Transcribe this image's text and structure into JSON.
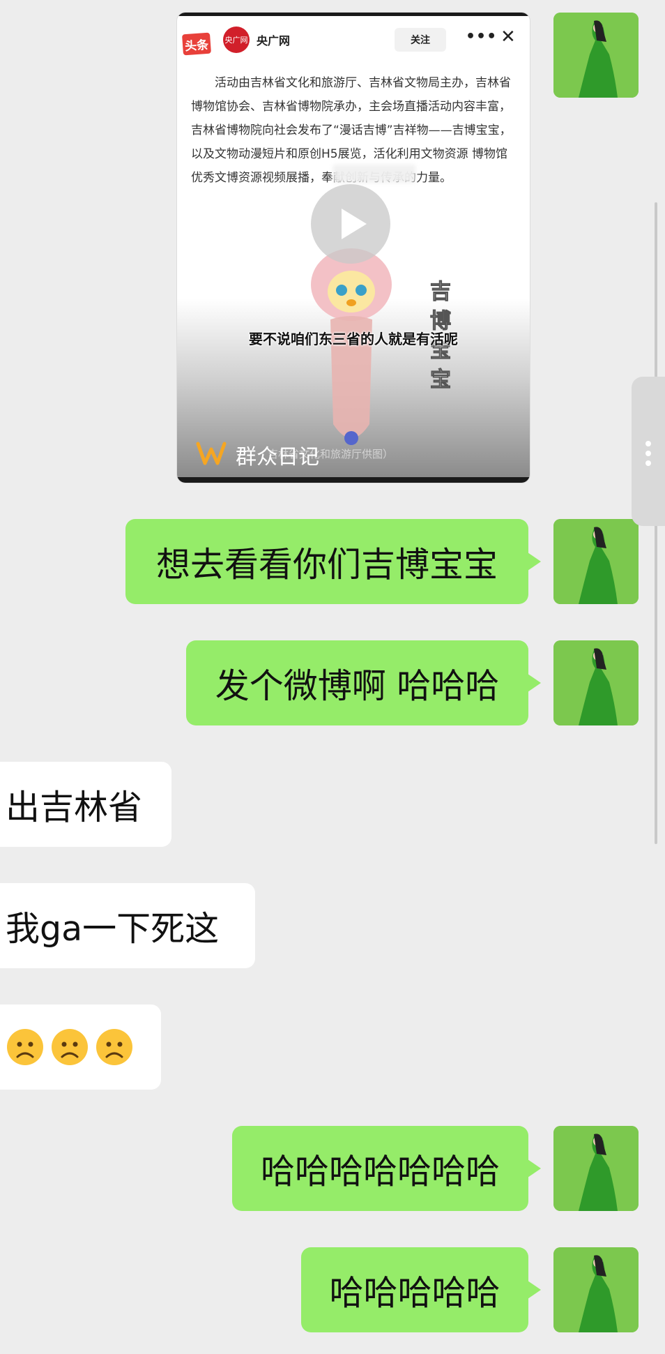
{
  "shared_card": {
    "app_logo_text": "头条",
    "source_logo_text": "央广网",
    "source_name": "央广网",
    "follow_label": "关注",
    "more_label": "•••",
    "close_label": "✕",
    "article_text": "活动由吉林省文化和旅游厅、吉林省文物局主办，吉林省博物馆协会、吉林省博物院承办，主会场直播活动内容丰富，吉林省博物院向社会发布了“漫话吉博”吉祥物——吉博宝宝，以及文物动漫短片和原创H5展览，活化利用文物资源 博物馆优秀文博资源视频展播，奉献创新与传承的力量。",
    "mascot_vertical_text": "吉博宝宝",
    "video_subtitle": "要不说咱们东三省的人就是有活呢",
    "image_caption": "吉林省文化和旅游厅供图）",
    "watermark": "群众日记"
  },
  "messages": [
    {
      "side": "me",
      "text": "想去看看你们吉博宝宝"
    },
    {
      "side": "me",
      "text": "发个微博啊 哈哈哈"
    },
    {
      "side": "other",
      "text": "出吉林省"
    },
    {
      "side": "other",
      "text": "我ga一下死这"
    },
    {
      "side": "other",
      "emoji": [
        "frowning-face",
        "frowning-face",
        "frowning-face"
      ]
    },
    {
      "side": "me",
      "text": "哈哈哈哈哈哈哈"
    },
    {
      "side": "me",
      "text": "哈哈哈哈哈"
    }
  ],
  "colors": {
    "my_bubble": "#95ec69",
    "other_bubble": "#ffffff",
    "background": "#ededed"
  }
}
